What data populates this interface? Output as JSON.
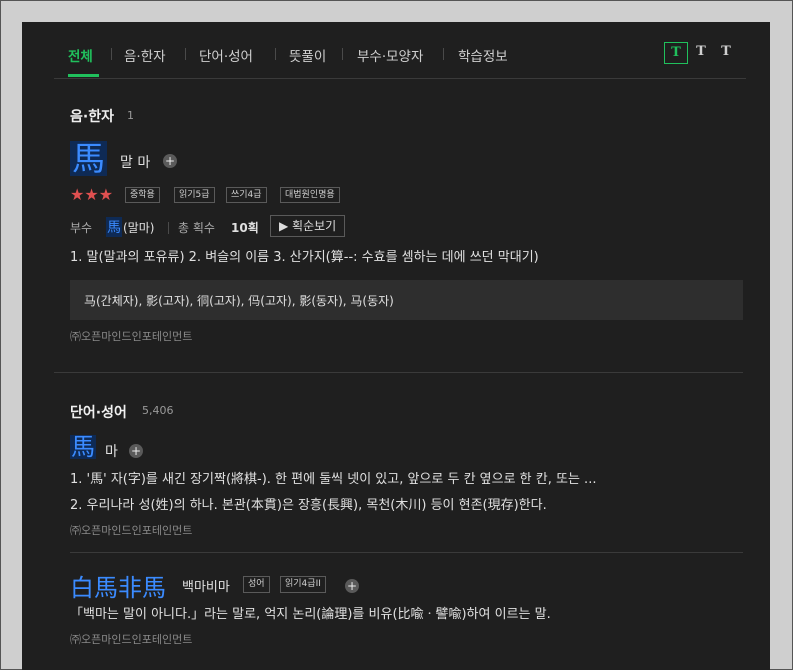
{
  "tabs": [
    "전체",
    "음·한자",
    "단어·성어",
    "뜻풀이",
    "부수·모양자",
    "학습정보"
  ],
  "font_buttons": [
    "T",
    "T",
    "T"
  ],
  "colors": {
    "accent": "#20c05c",
    "hanja_blue": "#3b8bff",
    "star_red": "#e05050"
  },
  "section1": {
    "title": "음·한자",
    "count": "1",
    "char": "馬",
    "reading": "말 마",
    "stars": "★★★",
    "badges": [
      "중학용",
      "읽기5급",
      "쓰기4급",
      "대법원인명용"
    ],
    "radical_label": "부수",
    "radical_char": "馬",
    "radical_reading": "(말마)",
    "stroke_label": "총 획수",
    "stroke_value": "10획",
    "stroke_button": "▶ 획순보기",
    "meanings": "1. 말(말과의 포유류)  2. 벼슬의 이름  3. 산가지(算--: 수효를 셈하는 데에 쓰던 막대기)",
    "variants": "马(간체자), 影(고자), 㣚(고자), 㐷(고자), 影(동자), 马(동자)",
    "copyright": "㈜오픈마인드인포테인먼트"
  },
  "section2": {
    "title": "단어·성어",
    "count": "5,406",
    "word1_char": "馬",
    "word1_reading": "마",
    "word1_def1": "1. '馬' 자(字)를 새긴 장기짝(將棋-). 한 편에 둘씩 넷이 있고, 앞으로 두 칸 옆으로 한 칸, 또는 ...",
    "word1_def2": "2. 우리나라 성(姓)의 하나. 본관(本貫)은 장흥(長興), 목천(木川) 등이 현존(現存)한다.",
    "word1_copyright": "㈜오픈마인드인포테인먼트",
    "idiom_chars": "白馬非馬",
    "idiom_reading": "백마비마",
    "idiom_badges": [
      "성어",
      "읽기4급II"
    ],
    "idiom_def": "「백마는 말이 아니다.」라는 말로, 억지 논리(論理)를 비유(比喩ㆍ譬喩)하여 이르는 말.",
    "idiom_copyright": "㈜오픈마인드인포테인먼트"
  }
}
